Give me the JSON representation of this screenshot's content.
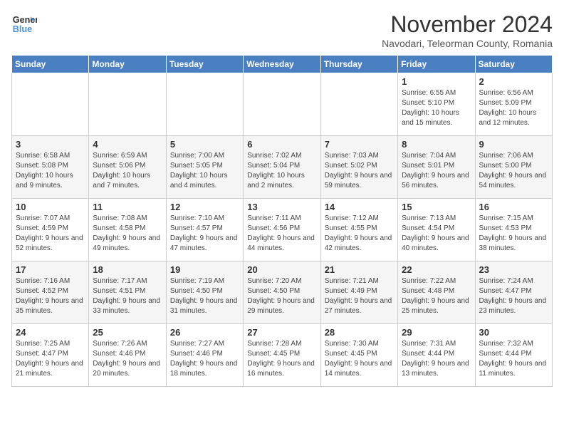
{
  "logo": {
    "text_general": "General",
    "text_blue": "Blue"
  },
  "title": "November 2024",
  "subtitle": "Navodari, Teleorman County, Romania",
  "days_of_week": [
    "Sunday",
    "Monday",
    "Tuesday",
    "Wednesday",
    "Thursday",
    "Friday",
    "Saturday"
  ],
  "weeks": [
    [
      {
        "day": "",
        "info": ""
      },
      {
        "day": "",
        "info": ""
      },
      {
        "day": "",
        "info": ""
      },
      {
        "day": "",
        "info": ""
      },
      {
        "day": "",
        "info": ""
      },
      {
        "day": "1",
        "info": "Sunrise: 6:55 AM\nSunset: 5:10 PM\nDaylight: 10 hours and 15 minutes."
      },
      {
        "day": "2",
        "info": "Sunrise: 6:56 AM\nSunset: 5:09 PM\nDaylight: 10 hours and 12 minutes."
      }
    ],
    [
      {
        "day": "3",
        "info": "Sunrise: 6:58 AM\nSunset: 5:08 PM\nDaylight: 10 hours and 9 minutes."
      },
      {
        "day": "4",
        "info": "Sunrise: 6:59 AM\nSunset: 5:06 PM\nDaylight: 10 hours and 7 minutes."
      },
      {
        "day": "5",
        "info": "Sunrise: 7:00 AM\nSunset: 5:05 PM\nDaylight: 10 hours and 4 minutes."
      },
      {
        "day": "6",
        "info": "Sunrise: 7:02 AM\nSunset: 5:04 PM\nDaylight: 10 hours and 2 minutes."
      },
      {
        "day": "7",
        "info": "Sunrise: 7:03 AM\nSunset: 5:02 PM\nDaylight: 9 hours and 59 minutes."
      },
      {
        "day": "8",
        "info": "Sunrise: 7:04 AM\nSunset: 5:01 PM\nDaylight: 9 hours and 56 minutes."
      },
      {
        "day": "9",
        "info": "Sunrise: 7:06 AM\nSunset: 5:00 PM\nDaylight: 9 hours and 54 minutes."
      }
    ],
    [
      {
        "day": "10",
        "info": "Sunrise: 7:07 AM\nSunset: 4:59 PM\nDaylight: 9 hours and 52 minutes."
      },
      {
        "day": "11",
        "info": "Sunrise: 7:08 AM\nSunset: 4:58 PM\nDaylight: 9 hours and 49 minutes."
      },
      {
        "day": "12",
        "info": "Sunrise: 7:10 AM\nSunset: 4:57 PM\nDaylight: 9 hours and 47 minutes."
      },
      {
        "day": "13",
        "info": "Sunrise: 7:11 AM\nSunset: 4:56 PM\nDaylight: 9 hours and 44 minutes."
      },
      {
        "day": "14",
        "info": "Sunrise: 7:12 AM\nSunset: 4:55 PM\nDaylight: 9 hours and 42 minutes."
      },
      {
        "day": "15",
        "info": "Sunrise: 7:13 AM\nSunset: 4:54 PM\nDaylight: 9 hours and 40 minutes."
      },
      {
        "day": "16",
        "info": "Sunrise: 7:15 AM\nSunset: 4:53 PM\nDaylight: 9 hours and 38 minutes."
      }
    ],
    [
      {
        "day": "17",
        "info": "Sunrise: 7:16 AM\nSunset: 4:52 PM\nDaylight: 9 hours and 35 minutes."
      },
      {
        "day": "18",
        "info": "Sunrise: 7:17 AM\nSunset: 4:51 PM\nDaylight: 9 hours and 33 minutes."
      },
      {
        "day": "19",
        "info": "Sunrise: 7:19 AM\nSunset: 4:50 PM\nDaylight: 9 hours and 31 minutes."
      },
      {
        "day": "20",
        "info": "Sunrise: 7:20 AM\nSunset: 4:50 PM\nDaylight: 9 hours and 29 minutes."
      },
      {
        "day": "21",
        "info": "Sunrise: 7:21 AM\nSunset: 4:49 PM\nDaylight: 9 hours and 27 minutes."
      },
      {
        "day": "22",
        "info": "Sunrise: 7:22 AM\nSunset: 4:48 PM\nDaylight: 9 hours and 25 minutes."
      },
      {
        "day": "23",
        "info": "Sunrise: 7:24 AM\nSunset: 4:47 PM\nDaylight: 9 hours and 23 minutes."
      }
    ],
    [
      {
        "day": "24",
        "info": "Sunrise: 7:25 AM\nSunset: 4:47 PM\nDaylight: 9 hours and 21 minutes."
      },
      {
        "day": "25",
        "info": "Sunrise: 7:26 AM\nSunset: 4:46 PM\nDaylight: 9 hours and 20 minutes."
      },
      {
        "day": "26",
        "info": "Sunrise: 7:27 AM\nSunset: 4:46 PM\nDaylight: 9 hours and 18 minutes."
      },
      {
        "day": "27",
        "info": "Sunrise: 7:28 AM\nSunset: 4:45 PM\nDaylight: 9 hours and 16 minutes."
      },
      {
        "day": "28",
        "info": "Sunrise: 7:30 AM\nSunset: 4:45 PM\nDaylight: 9 hours and 14 minutes."
      },
      {
        "day": "29",
        "info": "Sunrise: 7:31 AM\nSunset: 4:44 PM\nDaylight: 9 hours and 13 minutes."
      },
      {
        "day": "30",
        "info": "Sunrise: 7:32 AM\nSunset: 4:44 PM\nDaylight: 9 hours and 11 minutes."
      }
    ]
  ]
}
